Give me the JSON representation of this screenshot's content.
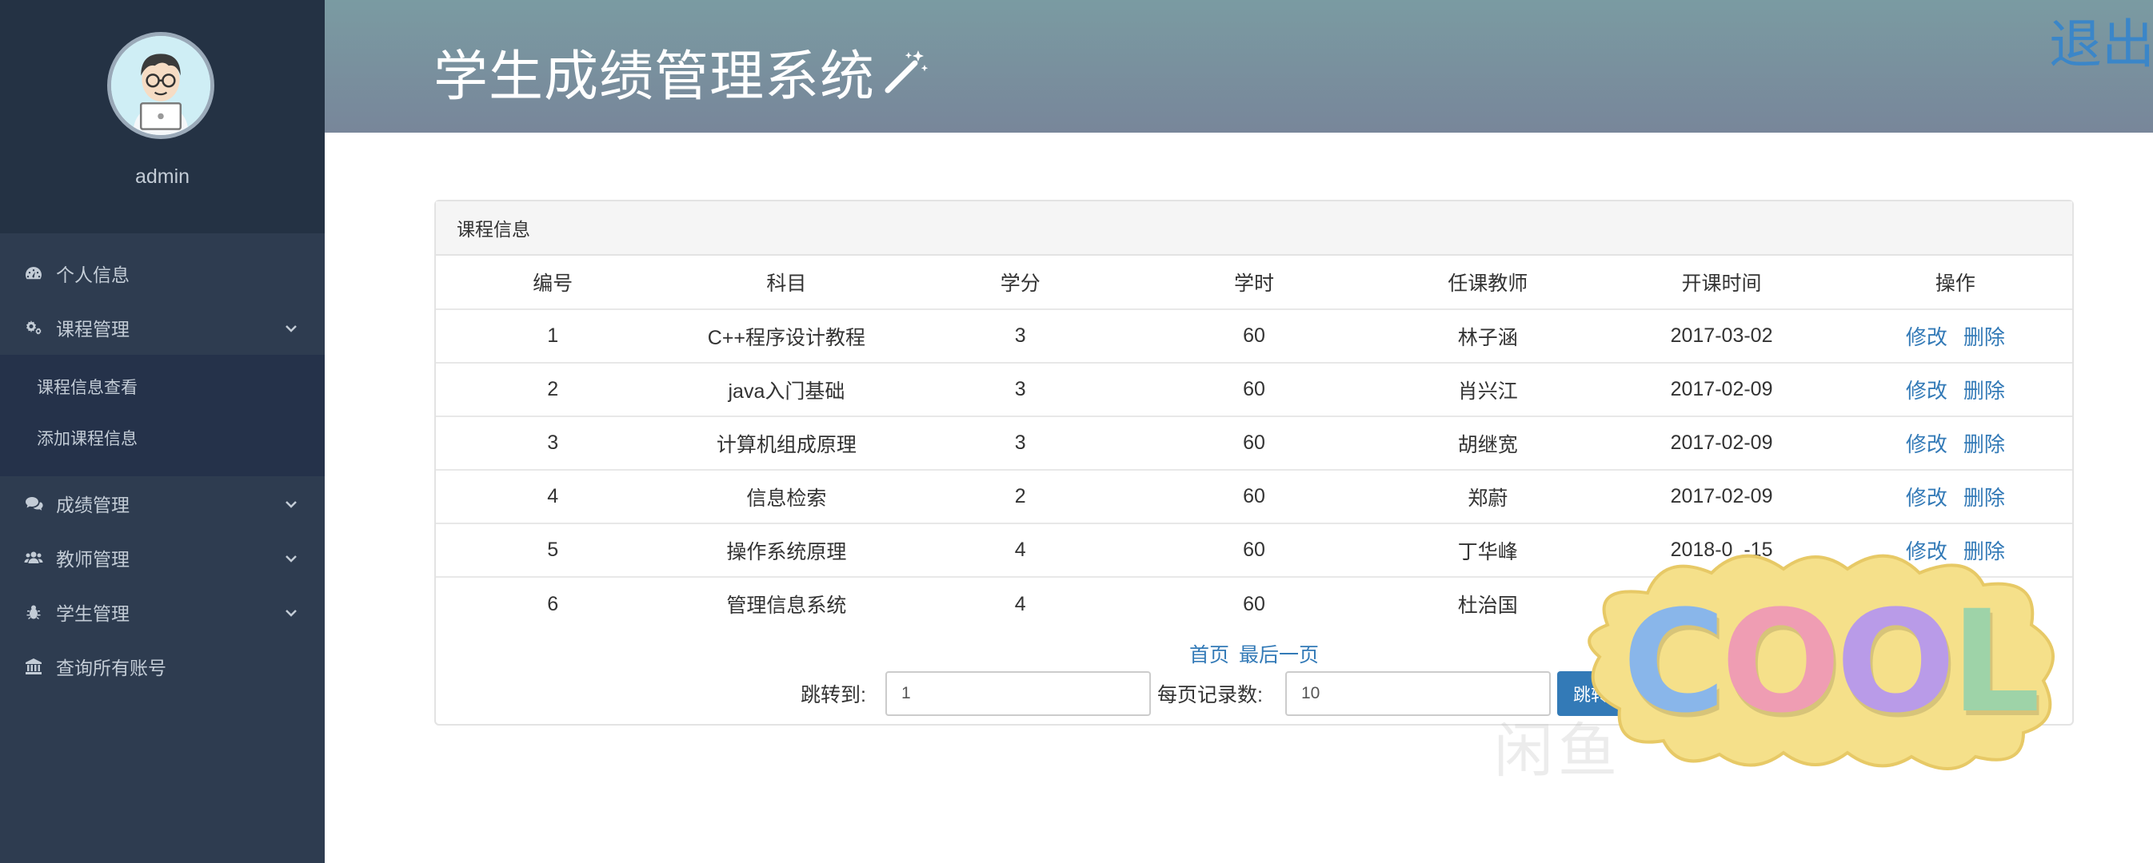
{
  "sidebar": {
    "username": "admin",
    "items": [
      {
        "label": "个人信息",
        "icon": "dashboard-icon"
      },
      {
        "label": "课程管理",
        "icon": "gears-icon",
        "expanded": true,
        "children": [
          {
            "label": "课程信息查看"
          },
          {
            "label": "添加课程信息"
          }
        ]
      },
      {
        "label": "成绩管理",
        "icon": "comments-icon"
      },
      {
        "label": "教师管理",
        "icon": "users-icon"
      },
      {
        "label": "学生管理",
        "icon": "bug-icon"
      },
      {
        "label": "查询所有账号",
        "icon": "bank-icon"
      }
    ]
  },
  "header": {
    "title": "学生成绩管理系统",
    "logout_label": "退出"
  },
  "panel": {
    "heading": "课程信息",
    "columns": [
      "编号",
      "科目",
      "学分",
      "学时",
      "任课教师",
      "开课时间",
      "操作"
    ],
    "rows": [
      {
        "id": "1",
        "subject": "C++程序设计教程",
        "credit": "3",
        "hours": "60",
        "teacher": "林子涵",
        "date": "2017-03-02"
      },
      {
        "id": "2",
        "subject": "java入门基础",
        "credit": "3",
        "hours": "60",
        "teacher": "肖兴江",
        "date": "2017-02-09"
      },
      {
        "id": "3",
        "subject": "计算机组成原理",
        "credit": "3",
        "hours": "60",
        "teacher": "胡继宽",
        "date": "2017-02-09"
      },
      {
        "id": "4",
        "subject": "信息检索",
        "credit": "2",
        "hours": "60",
        "teacher": "郑蔚",
        "date": "2017-02-09"
      },
      {
        "id": "5",
        "subject": "操作系统原理",
        "credit": "4",
        "hours": "60",
        "teacher": "丁华峰",
        "date": "2018-0_-15"
      },
      {
        "id": "6",
        "subject": "管理信息系统",
        "credit": "4",
        "hours": "60",
        "teacher": "杜治国",
        "date": ""
      }
    ],
    "edit_label": "修改",
    "delete_label": "删除"
  },
  "pager": {
    "first_label": "首页",
    "last_label": "最后一页",
    "jump_label": "跳转到:",
    "jump_value": "1",
    "page_size_label": "每页记录数:",
    "page_size_value": "10",
    "jump_button_label": "跳转"
  },
  "overlay": {
    "sticker_text": "COOL",
    "watermark_text": "闲鱼"
  }
}
